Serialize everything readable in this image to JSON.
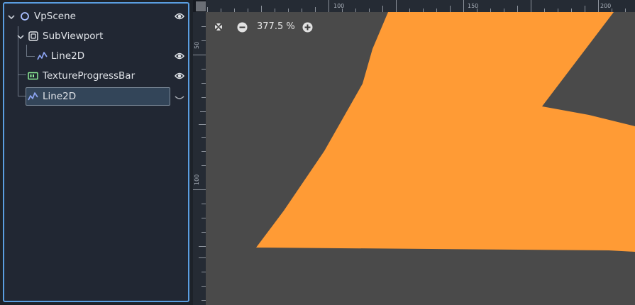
{
  "scene_tree": {
    "nodes": [
      {
        "label": "VpScene",
        "icon": "node-circle-icon",
        "visible": true
      },
      {
        "label": "SubViewport",
        "icon": "subviewport-icon"
      },
      {
        "label": "Line2D",
        "icon": "line2d-icon",
        "visible": true
      },
      {
        "label": "TextureProgressBar",
        "icon": "texture-progress-bar-icon",
        "visible": true
      },
      {
        "label": "Line2D",
        "icon": "line2d-icon",
        "selected": true
      }
    ]
  },
  "viewport": {
    "zoom_label": "377.5 %",
    "ruler_top_labels": [
      "100",
      "150",
      "200"
    ],
    "ruler_left_labels": [
      "50",
      "100"
    ],
    "shape_color": "#ff9b35",
    "background_color": "#4a4a4a"
  }
}
